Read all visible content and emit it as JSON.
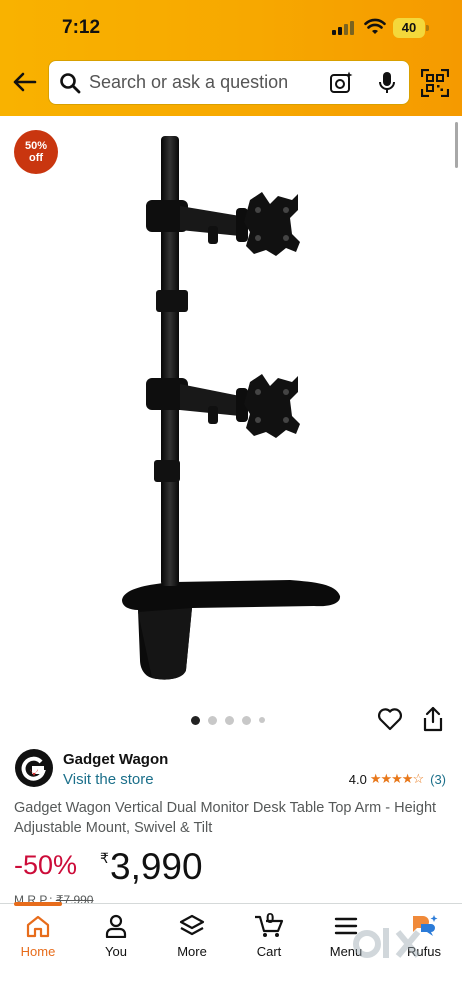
{
  "status_bar": {
    "time": "7:12",
    "battery": "40"
  },
  "search": {
    "placeholder": "Search or ask a question"
  },
  "product": {
    "badge_percent": "50%",
    "badge_word": "off",
    "image_count": 5,
    "active_image": 1
  },
  "seller": {
    "name": "Gadget Wagon",
    "store_link": "Visit the store",
    "rating": "4.0",
    "stars": "★★★★☆",
    "review_count": "(3)"
  },
  "title": "Gadget Wagon Vertical Dual Monitor Desk Table Top Arm - Height Adjustable Mount, Swivel & Tilt",
  "pricing": {
    "discount": "-50%",
    "currency": "₹",
    "price": "3,990",
    "mrp_label": "M.R.P.:",
    "mrp_value": "₹7,990"
  },
  "bottom_nav": {
    "home": "Home",
    "you": "You",
    "more": "More",
    "cart": "Cart",
    "cart_count": "0",
    "menu": "Menu",
    "rufus": "Rufus"
  },
  "watermark": "olx",
  "colors": {
    "header": "#f7a800",
    "accent": "#e76c1b",
    "badge": "#c9360f",
    "discount": "#cc0c39",
    "link": "#1b6f8a",
    "star": "#e8781b"
  }
}
